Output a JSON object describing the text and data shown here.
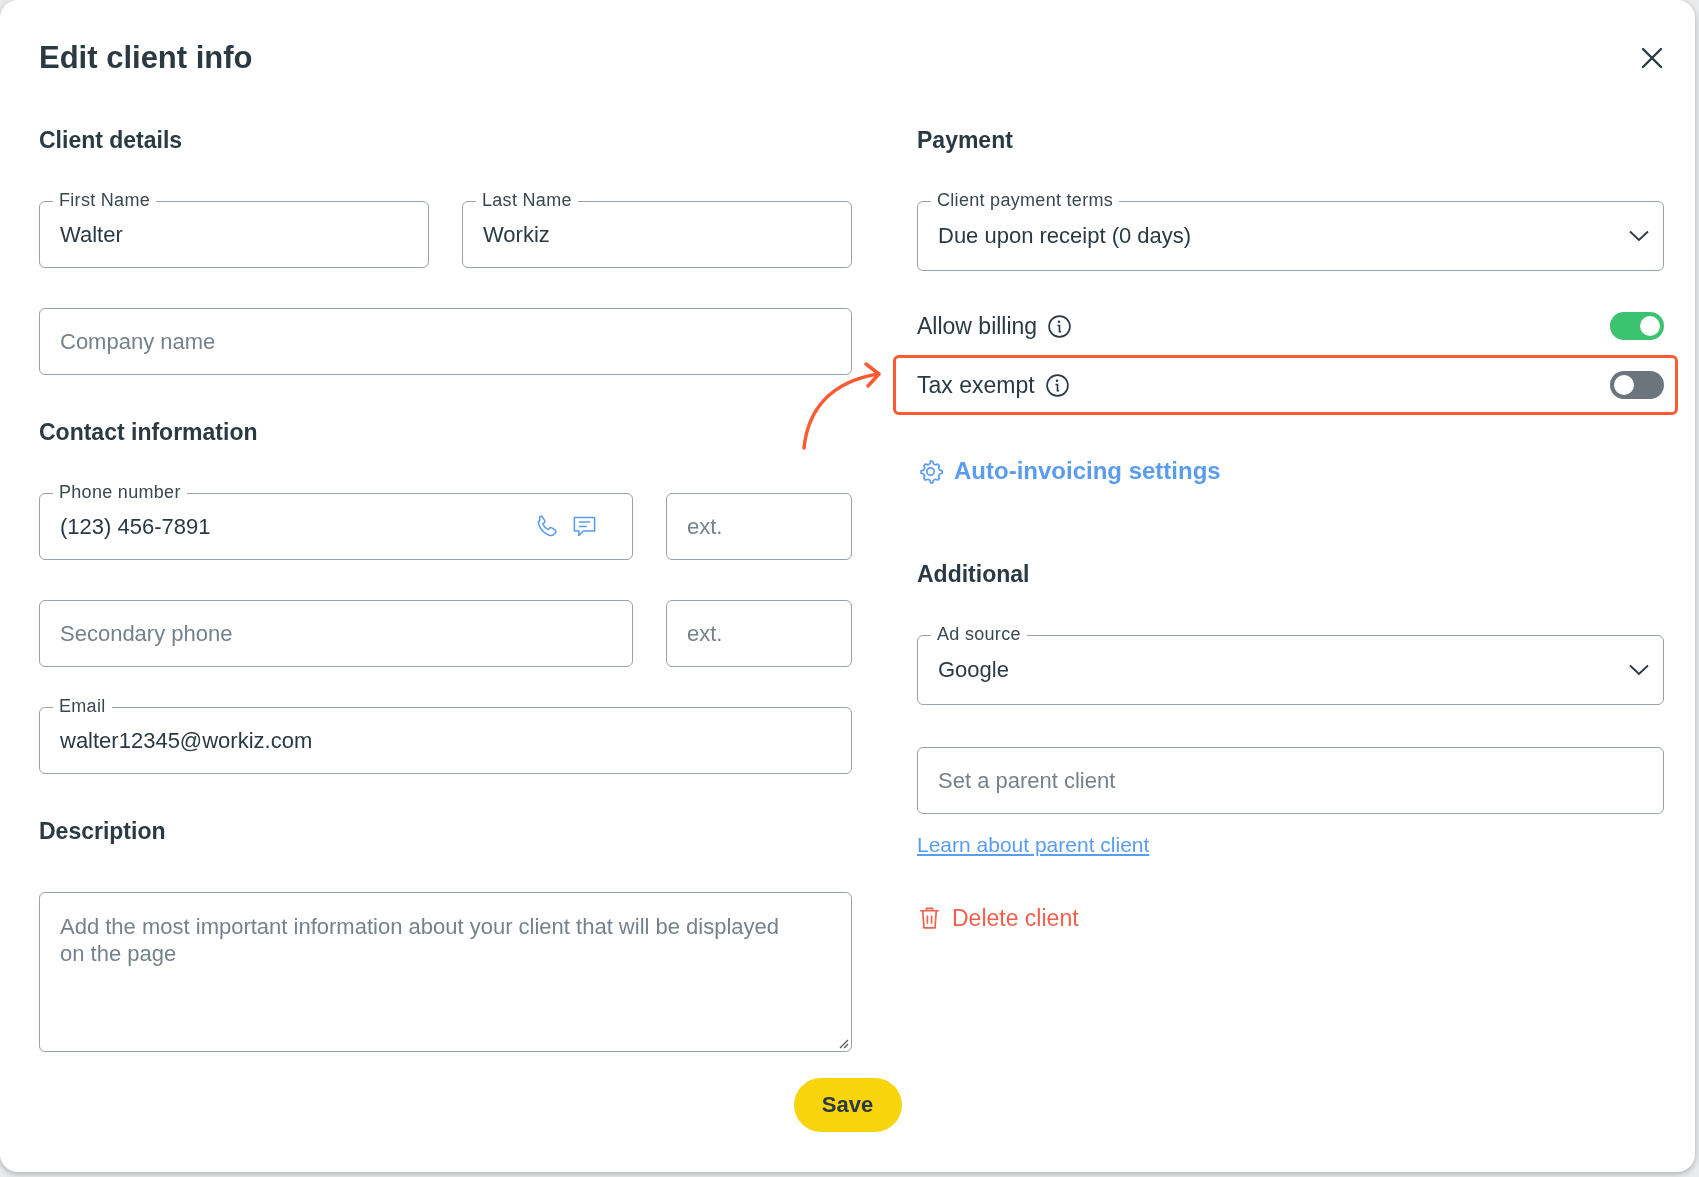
{
  "dialog": {
    "title": "Edit client info",
    "save": "Save"
  },
  "columns": [
    {
      "sections": [
        {
          "heading": "Client details",
          "items": [
            {
              "kind": "row",
              "fields": [
                {
                  "kind": "text",
                  "label": "First Name",
                  "value": "Walter"
                },
                {
                  "kind": "text",
                  "label": "Last Name",
                  "value": "Workiz"
                }
              ]
            },
            {
              "kind": "row",
              "fields": [
                {
                  "kind": "text",
                  "placeholder": "Company name"
                }
              ]
            }
          ]
        },
        {
          "heading": "Contact information",
          "items": [
            {
              "kind": "row",
              "fields": [
                {
                  "kind": "phone",
                  "label": "Phone number",
                  "value": "(123) 456-7891"
                },
                {
                  "kind": "ext",
                  "placeholder": "ext."
                }
              ]
            },
            {
              "kind": "row",
              "fields": [
                {
                  "kind": "text",
                  "placeholder": "Secondary phone"
                },
                {
                  "kind": "ext",
                  "placeholder": "ext."
                }
              ]
            },
            {
              "kind": "row",
              "fields": [
                {
                  "kind": "text",
                  "label": "Email",
                  "value": "walter12345@workiz.com"
                }
              ]
            }
          ]
        },
        {
          "heading": "Description",
          "items": [
            {
              "kind": "row",
              "fields": [
                {
                  "kind": "textarea",
                  "placeholder": "Add the most important information about your client that will be displayed on the page"
                }
              ]
            }
          ]
        }
      ]
    },
    {
      "sections": [
        {
          "heading": "Payment",
          "items": [
            {
              "kind": "row",
              "fields": [
                {
                  "kind": "select",
                  "label": "Client payment terms",
                  "value": "Due upon receipt (0 days)"
                }
              ]
            },
            {
              "kind": "toggle",
              "label": "Allow billing",
              "on": true,
              "highlighted": false
            },
            {
              "kind": "toggle",
              "label": "Tax exempt",
              "on": false,
              "highlighted": true
            },
            {
              "kind": "settings_link",
              "text": "Auto-invoicing settings"
            }
          ]
        },
        {
          "heading": "Additional",
          "items": [
            {
              "kind": "row",
              "fields": [
                {
                  "kind": "select",
                  "label": "Ad source",
                  "value": "Google"
                }
              ]
            },
            {
              "kind": "row",
              "fields": [
                {
                  "kind": "text",
                  "placeholder": "Set a parent client"
                }
              ]
            },
            {
              "kind": "link",
              "text": "Learn about parent client"
            },
            {
              "kind": "delete",
              "text": "Delete client"
            }
          ]
        }
      ]
    }
  ]
}
